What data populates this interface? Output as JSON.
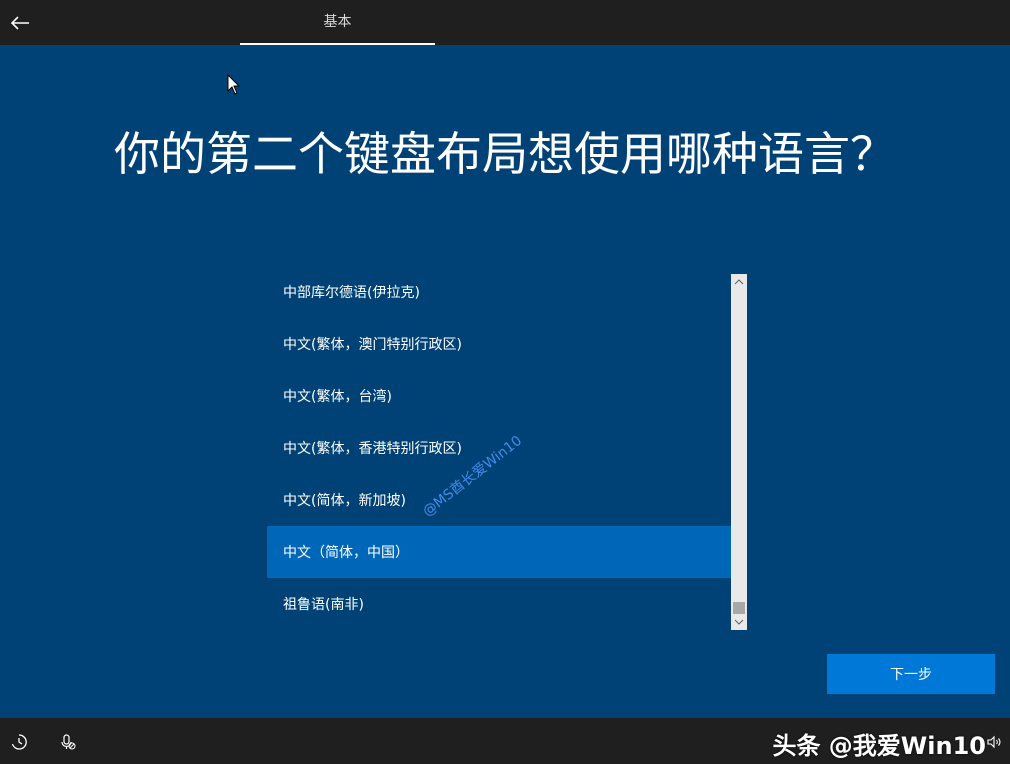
{
  "topbar": {
    "tab_label": "基本"
  },
  "page": {
    "title": "你的第二个键盘布局想使用哪种语言？"
  },
  "language_list": {
    "items": [
      "中部库尔德语(伊拉克)",
      "中文(繁体，澳门特别行政区)",
      "中文(繁体，台湾)",
      "中文(繁体，香港特别行政区)",
      "中文(简体，新加坡)",
      "中文（简体，中国）",
      "祖鲁语(南非)"
    ],
    "selected_index": 5
  },
  "watermark": {
    "text": "@MS酋长爱Win10"
  },
  "buttons": {
    "next_label": "下一步"
  },
  "bottombar": {
    "brand_text": "头条 @我爱Win10"
  },
  "icons": {
    "back": "arrow-left-icon",
    "ease_of_access": "ease-of-access-icon",
    "microphone": "microphone-icon",
    "volume": "volume-icon"
  },
  "colors": {
    "background": "#004275",
    "bar": "#1f1f1f",
    "selected": "#0067b8",
    "accent": "#0078d7"
  }
}
